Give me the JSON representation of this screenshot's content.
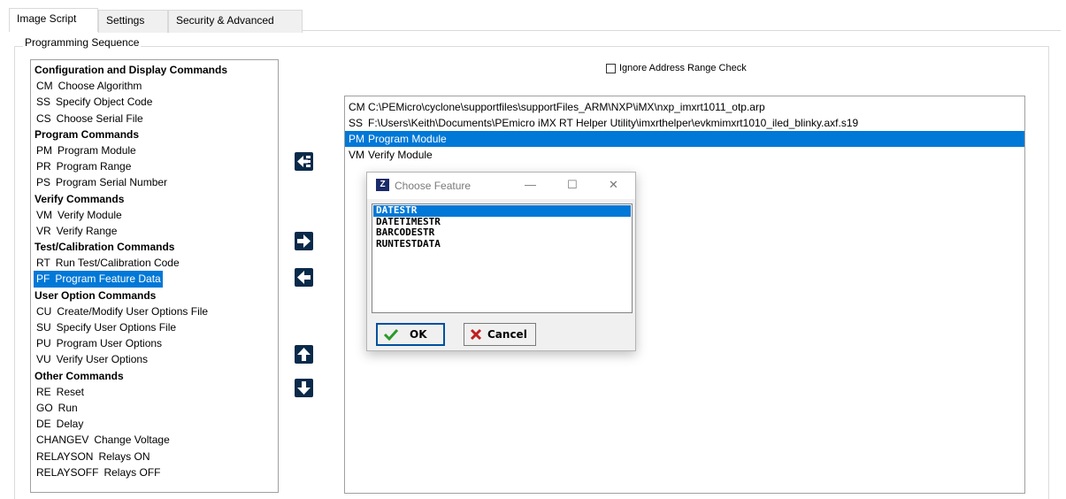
{
  "tabs": [
    {
      "label": "Image Script",
      "active": true
    },
    {
      "label": "Settings",
      "active": false
    },
    {
      "label": "Security & Advanced",
      "active": false
    }
  ],
  "group": {
    "legend": "Programming Sequence"
  },
  "commands": [
    {
      "type": "header",
      "label": "Configuration and Display Commands"
    },
    {
      "type": "item",
      "code": "CM",
      "label": "Choose Algorithm"
    },
    {
      "type": "item",
      "code": "SS",
      "label": "Specify Object Code"
    },
    {
      "type": "item",
      "code": "CS",
      "label": "Choose Serial File"
    },
    {
      "type": "header",
      "label": "Program Commands"
    },
    {
      "type": "item",
      "code": "PM",
      "label": "Program Module"
    },
    {
      "type": "item",
      "code": "PR",
      "label": "Program Range"
    },
    {
      "type": "item",
      "code": "PS",
      "label": "Program Serial Number"
    },
    {
      "type": "header",
      "label": "Verify Commands"
    },
    {
      "type": "item",
      "code": "VM",
      "label": "Verify Module"
    },
    {
      "type": "item",
      "code": "VR",
      "label": "Verify Range"
    },
    {
      "type": "header",
      "label": "Test/Calibration Commands"
    },
    {
      "type": "item",
      "code": "RT",
      "label": "Run Test/Calibration Code"
    },
    {
      "type": "item",
      "code": "PF",
      "label": "Program Feature Data",
      "selected": true
    },
    {
      "type": "header",
      "label": "User Option Commands"
    },
    {
      "type": "item",
      "code": "CU",
      "label": "Create/Modify User Options File"
    },
    {
      "type": "item",
      "code": "SU",
      "label": "Specify User Options File"
    },
    {
      "type": "item",
      "code": "PU",
      "label": "Program User Options"
    },
    {
      "type": "item",
      "code": "VU",
      "label": "Verify User Options"
    },
    {
      "type": "header",
      "label": "Other Commands"
    },
    {
      "type": "item",
      "code": "RE",
      "label": "Reset"
    },
    {
      "type": "item",
      "code": "GO",
      "label": "Run"
    },
    {
      "type": "item",
      "code": "DE",
      "label": "Delay"
    },
    {
      "type": "item",
      "code": "CHANGEV",
      "label": "Change Voltage"
    },
    {
      "type": "item",
      "code": "RELAYSON",
      "label": "Relays ON"
    },
    {
      "type": "item",
      "code": "RELAYSOFF",
      "label": "Relays OFF"
    }
  ],
  "ignore_check": {
    "label": "Ignore Address Range Check",
    "checked": false
  },
  "sequence": [
    {
      "code": "CM",
      "text": "C:\\PEMicro\\cyclone\\supportfiles\\supportFiles_ARM\\NXP\\iMX\\nxp_imxrt1011_otp.arp"
    },
    {
      "code": "SS",
      "text": "F:\\Users\\Keith\\Documents\\PEmicro iMX RT Helper Utility\\imxrthelper\\evkmimxrt1010_iled_blinky.axf.s19"
    },
    {
      "code": "PM",
      "text": "Program Module",
      "selected": true
    },
    {
      "code": "VM",
      "text": "Verify Module"
    }
  ],
  "dialog": {
    "title": "Choose Feature",
    "features": [
      {
        "label": "DATESTR",
        "selected": true
      },
      {
        "label": "DATETIMESTR"
      },
      {
        "label": "BARCODESTR"
      },
      {
        "label": "RUNTESTDATA"
      }
    ],
    "ok_label": "OK",
    "cancel_label": "Cancel"
  },
  "colors": {
    "selection": "#0078d7",
    "arrow_button": "#0a2a4a",
    "ok_check": "#2a9a2a",
    "cancel_x": "#c02020"
  }
}
